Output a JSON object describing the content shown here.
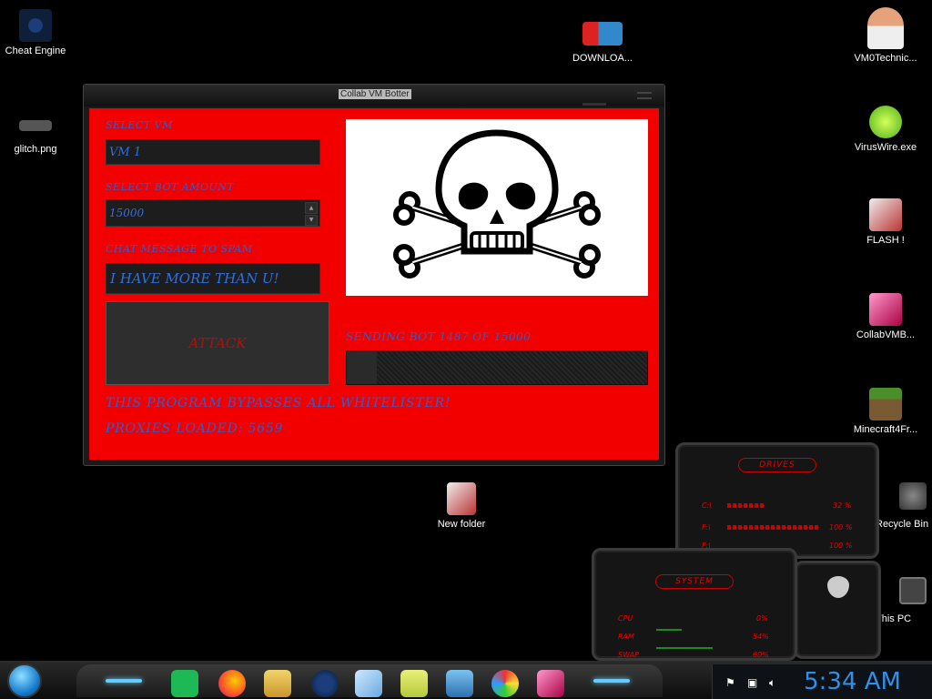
{
  "desktop": {
    "icons": [
      {
        "label": "Cheat Engine"
      },
      {
        "label": "glitch.png"
      },
      {
        "label": "DOWNLOA..."
      },
      {
        "label": "VM0Technic..."
      },
      {
        "label": "VirusWire.exe"
      },
      {
        "label": "FLASH !"
      },
      {
        "label": "CollabVMB..."
      },
      {
        "label": "Minecraft4Fr..."
      },
      {
        "label": "Recycle Bin"
      },
      {
        "label": "This PC"
      },
      {
        "label": "New folder"
      }
    ]
  },
  "window": {
    "title": "Collab VM Botter",
    "select_vm_label": "SELECT VM",
    "select_vm_value": "VM 1",
    "bot_amount_label": "SELECT BOT AMOUNT",
    "bot_amount_value": "15000",
    "chat_label": "CHAT MESSAGE TO SPAM",
    "chat_value": "I HAVE MORE THAN U!",
    "attack_label": "ATTACK",
    "status_text": "SENDING BOT 1487 OF 15000",
    "progress_fraction": 0.0991,
    "bypass_text": "THIS PROGRAM BYPASSES ALL WHITELISTER!",
    "proxies_text": "PROXIES LOADED: 5659"
  },
  "gadgets": {
    "drives": {
      "title": "DRIVES",
      "rows": [
        {
          "label": "C:\\",
          "value": "32 %"
        },
        {
          "label": "F:\\",
          "value": "100 %"
        },
        {
          "label": "F:\\",
          "value": "100 %"
        }
      ]
    },
    "system": {
      "title": "SYSTEM",
      "rows": [
        {
          "label": "CPU",
          "value": "0%"
        },
        {
          "label": "RAM",
          "value": "54%"
        },
        {
          "label": "SWAP",
          "value": "60%"
        }
      ]
    }
  },
  "taskbar": {
    "clock": "5:34 AM"
  }
}
